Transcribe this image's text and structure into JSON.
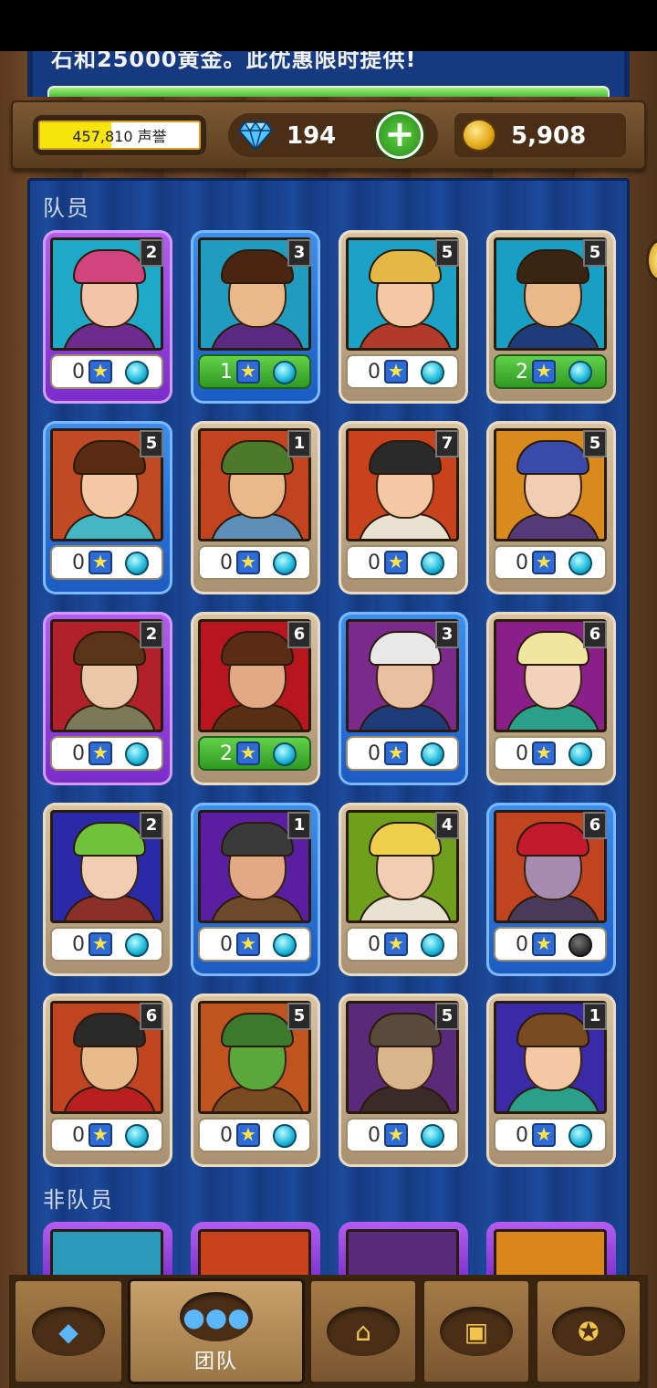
{
  "banner": {
    "text": "石和25000黄金。此优惠限时提供!"
  },
  "header": {
    "reputation": {
      "text": "457,810 声誉",
      "progress": 0.45
    },
    "gems": {
      "count": "194",
      "icon": "diamond-icon",
      "add_label": "+"
    },
    "gold": {
      "count": "5,908",
      "icon": "gold-coin-icon"
    }
  },
  "sections": {
    "members_title": "队员",
    "non_members_title": "非队员"
  },
  "members": [
    {
      "level": "2",
      "stars": "0",
      "rarity": "purple",
      "highlight": false,
      "orb": "active",
      "portrait": "elf-woman-with-potion",
      "skin": "#f3c4a8",
      "bg": "#1ea9c9",
      "hair": "#d2447e",
      "shirt": "#6d2a8f"
    },
    {
      "level": "3",
      "stars": "1",
      "rarity": "blue",
      "highlight": true,
      "orb": "active",
      "portrait": "bearded-mage-man",
      "skin": "#e9b98a",
      "bg": "#1f9cc0",
      "hair": "#4a2612",
      "shirt": "#5a2a82"
    },
    {
      "level": "5",
      "stars": "0",
      "rarity": "tan",
      "highlight": false,
      "orb": "active",
      "portrait": "blonde-woman-with-potion",
      "skin": "#f3c8a2",
      "bg": "#1aa3c7",
      "hair": "#e5b845",
      "shirt": "#b23a2a"
    },
    {
      "level": "5",
      "stars": "2",
      "rarity": "tan",
      "highlight": true,
      "orb": "active",
      "portrait": "mustached-general",
      "skin": "#e9b98a",
      "bg": "#18a0c4",
      "hair": "#3a2412",
      "shirt": "#1e3b7a"
    },
    {
      "level": "5",
      "stars": "0",
      "rarity": "blue",
      "highlight": false,
      "orb": "active",
      "portrait": "cook-woman",
      "skin": "#f3c8a2",
      "bg": "#c04a24",
      "hair": "#5a2a12",
      "shirt": "#45b7c4"
    },
    {
      "level": "1",
      "stars": "0",
      "rarity": "tan",
      "highlight": false,
      "orb": "active",
      "portrait": "old-hunter-with-hat",
      "skin": "#e9b98a",
      "bg": "#c1441f",
      "hair": "#4d7a2a",
      "shirt": "#5e8fb8"
    },
    {
      "level": "7",
      "stars": "0",
      "rarity": "tan",
      "highlight": false,
      "orb": "active",
      "portrait": "barmaid-with-beer",
      "skin": "#f3c8a2",
      "bg": "#c8421c",
      "hair": "#2a2a2a",
      "shirt": "#e8e2d0"
    },
    {
      "level": "5",
      "stars": "0",
      "rarity": "tan",
      "highlight": false,
      "orb": "active",
      "portrait": "elf-man",
      "skin": "#f1cdb2",
      "bg": "#d98a1c",
      "hair": "#3a4aa8",
      "shirt": "#553a7a"
    },
    {
      "level": "2",
      "stars": "0",
      "rarity": "purple",
      "highlight": false,
      "orb": "active",
      "portrait": "scared-man-with-ghost",
      "skin": "#e9c8a8",
      "bg": "#b2202a",
      "hair": "#5a3418",
      "shirt": "#7a7a5a"
    },
    {
      "level": "6",
      "stars": "2",
      "rarity": "tan",
      "highlight": true,
      "orb": "active",
      "portrait": "strong-woman",
      "skin": "#e2a984",
      "bg": "#b8161f",
      "hair": "#5a2c14",
      "shirt": "#5a3014"
    },
    {
      "level": "3",
      "stars": "0",
      "rarity": "blue",
      "highlight": false,
      "orb": "active",
      "portrait": "old-wizard",
      "skin": "#e9c0a0",
      "bg": "#7a2a8a",
      "hair": "#e8e8e8",
      "shirt": "#1e3b7a"
    },
    {
      "level": "6",
      "stars": "0",
      "rarity": "tan",
      "highlight": false,
      "orb": "active",
      "portrait": "fur-hood-woman",
      "skin": "#f3d2bc",
      "bg": "#8a1f8a",
      "hair": "#f0e6a0",
      "shirt": "#2aa08a"
    },
    {
      "level": "2",
      "stars": "0",
      "rarity": "tan",
      "highlight": false,
      "orb": "active",
      "portrait": "green-haired-elf",
      "skin": "#f1cdb2",
      "bg": "#2a2aa8",
      "hair": "#6fc23a",
      "shirt": "#8a2f2a"
    },
    {
      "level": "1",
      "stars": "0",
      "rarity": "blue",
      "highlight": false,
      "orb": "active",
      "portrait": "bearded-man",
      "skin": "#e2a984",
      "bg": "#5a1fa0",
      "hair": "#3a3a3a",
      "shirt": "#6a4a2a"
    },
    {
      "level": "4",
      "stars": "0",
      "rarity": "tan",
      "highlight": false,
      "orb": "active",
      "portrait": "blonde-man-with-goblet",
      "skin": "#f1cdb2",
      "bg": "#6fa01c",
      "hair": "#f0d04a",
      "shirt": "#e8e2d0"
    },
    {
      "level": "6",
      "stars": "0",
      "rarity": "blue",
      "highlight": false,
      "orb": "inactive",
      "portrait": "demon-woman",
      "skin": "#a68ab0",
      "bg": "#c0441f",
      "hair": "#c21a2a",
      "shirt": "#4a3a5a"
    },
    {
      "level": "6",
      "stars": "0",
      "rarity": "tan",
      "highlight": false,
      "orb": "active",
      "portrait": "dapper-man",
      "skin": "#e9b98a",
      "bg": "#c0441f",
      "hair": "#2a2a2a",
      "shirt": "#b82020"
    },
    {
      "level": "5",
      "stars": "0",
      "rarity": "tan",
      "highlight": false,
      "orb": "active",
      "portrait": "orc",
      "skin": "#5aa83a",
      "bg": "#c0541f",
      "hair": "#3a7a2a",
      "shirt": "#7a4a20"
    },
    {
      "level": "5",
      "stars": "0",
      "rarity": "tan",
      "highlight": false,
      "orb": "active",
      "portrait": "bald-old-man",
      "skin": "#d8b58a",
      "bg": "#5a2a7a",
      "hair": "#5a4a3a",
      "shirt": "#3a2a2a"
    },
    {
      "level": "1",
      "stars": "0",
      "rarity": "tan",
      "highlight": false,
      "orb": "active",
      "portrait": "woman-with-hammer",
      "skin": "#f3c8a2",
      "bg": "#3a2aa8",
      "hair": "#7a4a20",
      "shirt": "#2aa08a"
    }
  ],
  "non_members": [
    {
      "portrait": "old-woman-santa-hat",
      "bg": "#2a9ab8"
    },
    {
      "portrait": "man-with-cap",
      "bg": "#c8421c"
    },
    {
      "portrait": "dark-haired-woman",
      "bg": "#5a2a7a"
    },
    {
      "portrait": "teal-haired-elf",
      "bg": "#d9861c"
    }
  ],
  "nav": [
    {
      "id": "gems",
      "label": "",
      "icon": "diamond-icon",
      "glyph": "◆",
      "active": false
    },
    {
      "id": "team",
      "label": "团队",
      "icon": "team-icon",
      "glyph": "●●●",
      "active": true
    },
    {
      "id": "buildings",
      "label": "",
      "icon": "house-icon",
      "glyph": "⌂",
      "active": false
    },
    {
      "id": "chest",
      "label": "",
      "icon": "chest-icon",
      "glyph": "▣",
      "active": false
    },
    {
      "id": "achievements",
      "label": "",
      "icon": "medal-icon",
      "glyph": "✪",
      "active": false
    }
  ]
}
